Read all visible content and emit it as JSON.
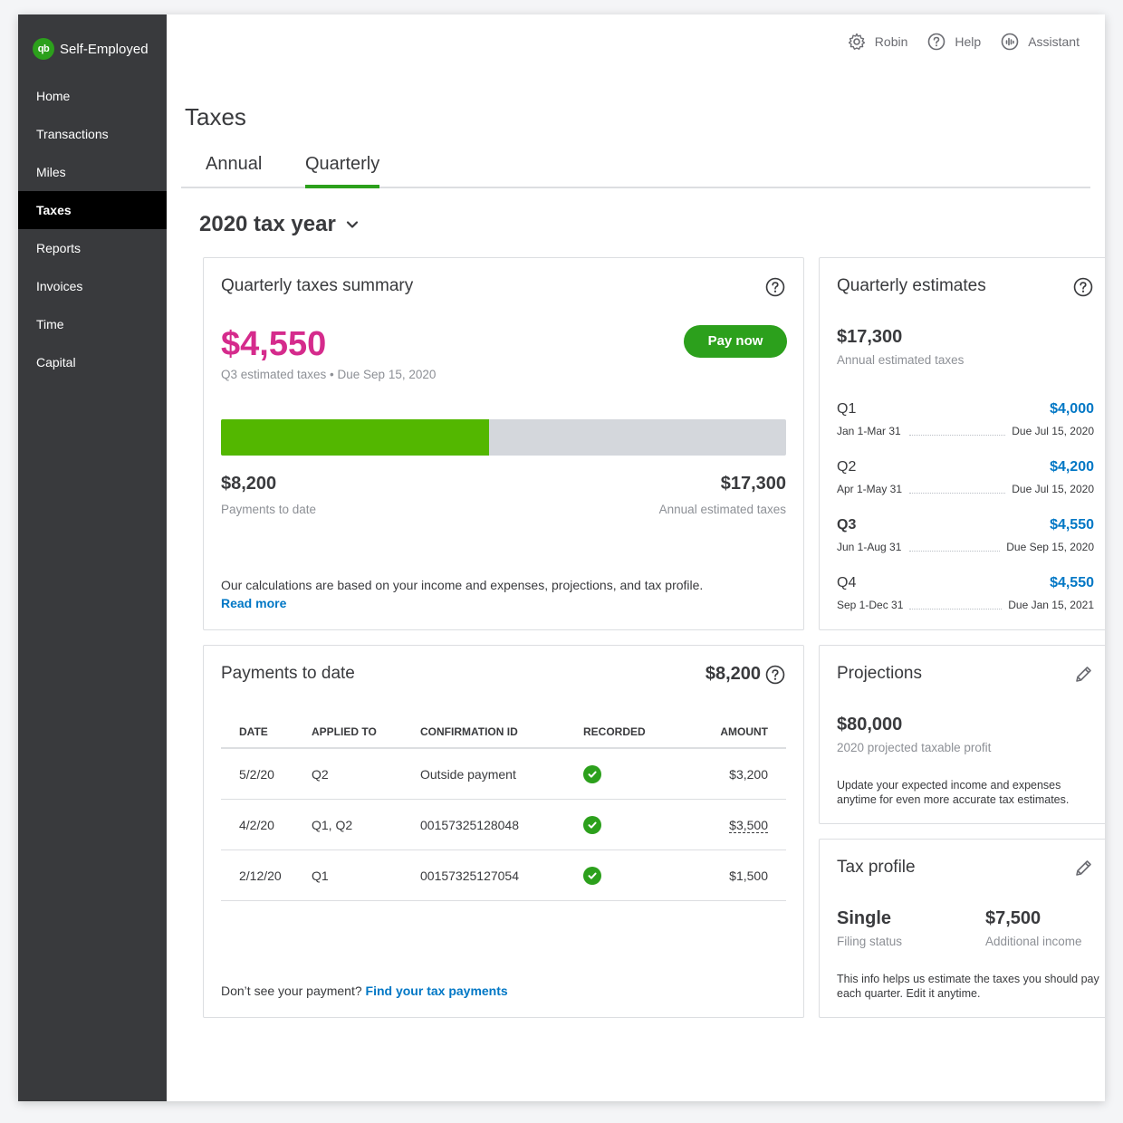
{
  "sidebar": {
    "brand_logo": "qb",
    "brand_name": "Self-Employed",
    "items": [
      {
        "label": "Home"
      },
      {
        "label": "Transactions"
      },
      {
        "label": "Miles"
      },
      {
        "label": "Taxes",
        "active": true
      },
      {
        "label": "Reports"
      },
      {
        "label": "Invoices"
      },
      {
        "label": "Time"
      },
      {
        "label": "Capital"
      }
    ]
  },
  "topbar": {
    "user": "Robin",
    "help": "Help",
    "assistant": "Assistant"
  },
  "page": {
    "title": "Taxes",
    "tabs": [
      {
        "label": "Annual",
        "active": false
      },
      {
        "label": "Quarterly",
        "active": true
      }
    ],
    "tax_year": "2020 tax year"
  },
  "summary": {
    "title": "Quarterly taxes summary",
    "amount": "$4,550",
    "subtitle": "Q3 estimated taxes • Due Sep 15, 2020",
    "pay_button": "Pay now",
    "progress_fraction": 0.474,
    "paid_amount": "$8,200",
    "paid_label": "Payments to date",
    "annual_amount": "$17,300",
    "annual_label": "Annual estimated taxes",
    "note": "Our calculations are based on your income and expenses, projections, and tax profile.",
    "read_more": "Read more"
  },
  "estimates": {
    "title": "Quarterly estimates",
    "annual_amount": "$17,300",
    "annual_label": "Annual estimated taxes",
    "quarters": [
      {
        "label": "Q1",
        "amount": "$4,000",
        "range": "Jan 1-Mar 31",
        "due": "Due Jul 15, 2020",
        "current": false
      },
      {
        "label": "Q2",
        "amount": "$4,200",
        "range": "Apr 1-May 31",
        "due": "Due Jul 15, 2020",
        "current": false
      },
      {
        "label": "Q3",
        "amount": "$4,550",
        "range": "Jun 1-Aug 31",
        "due": "Due Sep 15, 2020",
        "current": true
      },
      {
        "label": "Q4",
        "amount": "$4,550",
        "range": "Sep 1-Dec 31",
        "due": "Due Jan 15, 2021",
        "current": false
      }
    ]
  },
  "payments": {
    "title": "Payments to date",
    "total": "$8,200",
    "headers": {
      "date": "DATE",
      "applied": "APPLIED TO",
      "confirmation": "CONFIRMATION ID",
      "recorded": "RECORDED",
      "amount": "AMOUNT"
    },
    "rows": [
      {
        "date": "5/2/20",
        "applied": "Q2",
        "confirmation": "Outside payment",
        "amount": "$3,200"
      },
      {
        "date": "4/2/20",
        "applied": "Q1, Q2",
        "confirmation": "00157325128048",
        "amount": "$3,500"
      },
      {
        "date": "2/12/20",
        "applied": "Q1",
        "confirmation": "00157325127054",
        "amount": "$1,500"
      }
    ],
    "footer_text": "Don’t see your payment?",
    "footer_link": "Find your tax payments"
  },
  "projections": {
    "title": "Projections",
    "amount": "$80,000",
    "label": "2020 projected taxable profit",
    "note": "Update your expected income and expenses anytime for even more accurate tax estimates."
  },
  "tax_profile": {
    "title": "Tax profile",
    "filing_value": "Single",
    "filing_label": "Filing status",
    "income_value": "$7,500",
    "income_label": "Additional income",
    "note": "This info helps us estimate the taxes you should pay each quarter. Edit it anytime."
  },
  "colors": {
    "brand_green": "#2ca01c",
    "progress_green": "#53b700",
    "amount_pink": "#d52b8c",
    "link_blue": "#0077c5",
    "sidebar_bg": "#393a3d"
  }
}
